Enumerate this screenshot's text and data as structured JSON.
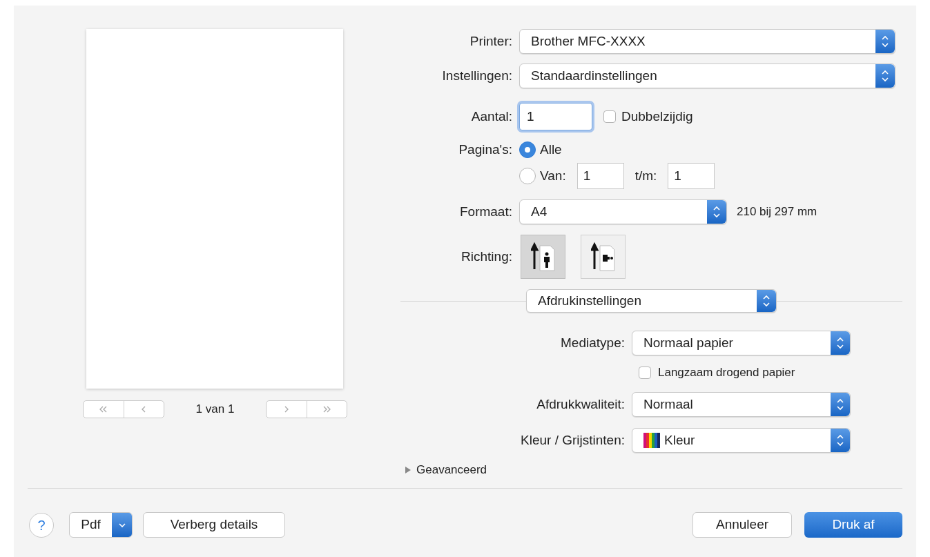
{
  "preview": {
    "page_indicator": "1 van 1"
  },
  "printer": {
    "label": "Printer:",
    "value": "Brother MFC-XXXX"
  },
  "presets": {
    "label": "Instellingen:",
    "value": "Standaardinstellingen"
  },
  "copies": {
    "label": "Aantal:",
    "value": "1",
    "focused": true
  },
  "duplex": {
    "label": "Dubbelzijdig",
    "checked": false
  },
  "pages": {
    "label": "Pagina's:",
    "options": [
      {
        "label": "Alle",
        "selected": true
      },
      {
        "label": "Van:",
        "selected": false
      }
    ],
    "from": "1",
    "to_label": "t/m:",
    "to": "1"
  },
  "paper_size": {
    "label": "Formaat:",
    "value": "A4",
    "dimensions": "210 bij 297 mm"
  },
  "orientation": {
    "label": "Richting:",
    "options": [
      {
        "kind": "portrait",
        "selected": true
      },
      {
        "kind": "landscape",
        "selected": false
      }
    ]
  },
  "section_menu": {
    "value": "Afdrukinstellingen"
  },
  "settings": [
    {
      "kind": "popup",
      "label": "Mediatype:",
      "value": "Normaal papier"
    },
    {
      "kind": "checkbox",
      "label": "Langzaam drogend papier",
      "checked": false
    },
    {
      "kind": "popup",
      "label": "Afdrukkwaliteit:",
      "value": "Normaal"
    },
    {
      "kind": "color-popup",
      "label": "Kleur / Grijstinten:",
      "value": "Kleur"
    }
  ],
  "advanced": {
    "label": "Geavanceerd",
    "expanded": false
  },
  "footer": {
    "help": "?",
    "pdf": "Pdf",
    "details": "Verberg details",
    "cancel": "Annuleer",
    "print": "Druk af"
  }
}
